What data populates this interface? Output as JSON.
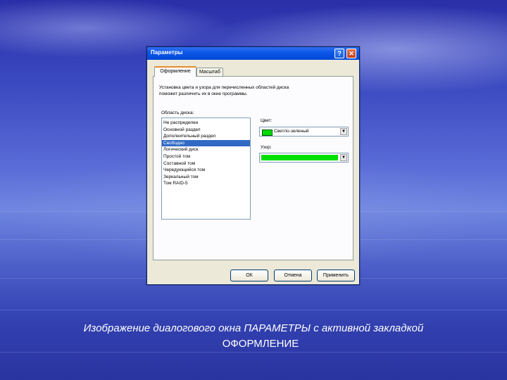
{
  "dialog": {
    "title": "Параметры",
    "help_label": "?",
    "close_label": "✕",
    "tabs": [
      {
        "label": "Оформление",
        "active": true
      },
      {
        "label": "Масштаб",
        "active": false
      }
    ],
    "description_line1": "Установка цвета и узора для перечисленных областей диска",
    "description_line2": "поможет различить их в окне программы.",
    "area_label": "Область диска:",
    "list_items": [
      "Не распределен",
      "Основной раздел",
      "Дополнительный раздел",
      "Свободно",
      "Логический диск",
      "Простой том",
      "Составной том",
      "Чередующийся том",
      "Зеркальный том",
      "Том RAID-5"
    ],
    "selected_index": 3,
    "color_label": "Цвет:",
    "color_value": "Светло-зеленый",
    "color_hex": "#00d800",
    "pattern_label": "Узор:",
    "pattern_hex": "#00e000",
    "ok_label": "ОК",
    "cancel_label": "Отмена",
    "apply_label": "Применить"
  },
  "caption": {
    "line1": "Изображение диалогового окна ПАРАМЕТРЫ с активной закладкой",
    "line2": "ОФОРМЛЕНИЕ"
  }
}
